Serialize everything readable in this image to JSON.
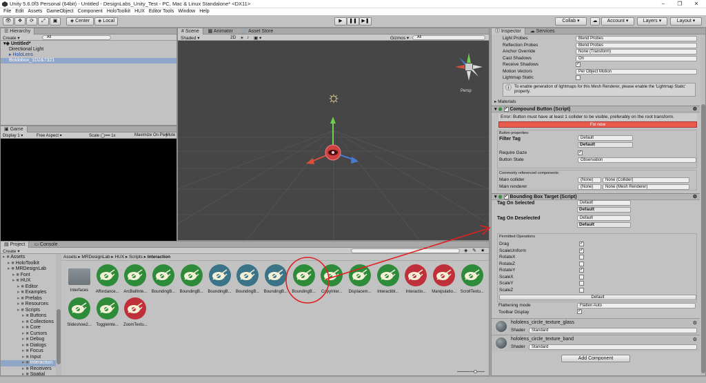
{
  "window": {
    "title": "Unity 5.6.0f3 Personal (64bit) - Untitled - DesignLabs_Unity_Test - PC, Mac & Linux Standalone* <DX11>"
  },
  "menu": [
    "File",
    "Edit",
    "Assets",
    "GameObject",
    "Component",
    "HoloToolkit",
    "HUX",
    "Editor Tools",
    "Window",
    "Help"
  ],
  "toolbar": {
    "center": "Center",
    "local": "Local",
    "collab": "Collab",
    "account": "Account",
    "layers": "Layers",
    "layout": "Layout"
  },
  "hierarchy": {
    "tab": "Hierarchy",
    "create": "Create",
    "search": "All",
    "items": [
      {
        "label": "Untitled*",
        "indent": 0,
        "bold": true
      },
      {
        "label": "Directional Light",
        "indent": 1
      },
      {
        "label": "HoloLens",
        "indent": 1,
        "blue": true
      },
      {
        "label": "Boldobox_1D2&7321",
        "indent": 1,
        "selected": true
      }
    ]
  },
  "scene": {
    "tabs": [
      "Scene",
      "Animator",
      "Asset Store"
    ],
    "shading": "Shaded",
    "mode_2d": "2D",
    "gizmos": "Gizmos",
    "search": "All",
    "persp": "Persp"
  },
  "game": {
    "tab": "Game",
    "display": "Display 1",
    "aspect": "Free Aspect",
    "scale": "Scale",
    "scale_val": "1x",
    "maximize": "Maximize On Play",
    "mute": "Mute"
  },
  "project": {
    "tabs": [
      "Project",
      "Console"
    ],
    "create": "Create",
    "breadcrumb": [
      "Assets",
      "MRDesignLab",
      "HUX",
      "Scripts",
      "Interaction"
    ],
    "tree": [
      {
        "label": "Assets",
        "indent": 0
      },
      {
        "label": "HoloToolkit",
        "indent": 1
      },
      {
        "label": "MRDesignLab",
        "indent": 1
      },
      {
        "label": "Font",
        "indent": 2
      },
      {
        "label": "HUX",
        "indent": 2
      },
      {
        "label": "Editor",
        "indent": 3
      },
      {
        "label": "Examples",
        "indent": 3
      },
      {
        "label": "Prefabs",
        "indent": 3
      },
      {
        "label": "Resources",
        "indent": 3
      },
      {
        "label": "Scripts",
        "indent": 3
      },
      {
        "label": "Buttons",
        "indent": 4
      },
      {
        "label": "Collections",
        "indent": 4
      },
      {
        "label": "Core",
        "indent": 4
      },
      {
        "label": "Cursors",
        "indent": 4
      },
      {
        "label": "Debug",
        "indent": 4
      },
      {
        "label": "Dialogs",
        "indent": 4
      },
      {
        "label": "Focus",
        "indent": 4
      },
      {
        "label": "Input",
        "indent": 4
      },
      {
        "label": "Interaction",
        "indent": 4,
        "selected": true
      },
      {
        "label": "Receivers",
        "indent": 4
      },
      {
        "label": "Spatial",
        "indent": 4
      }
    ],
    "assets": [
      {
        "label": "Interfaces",
        "color": "folder"
      },
      {
        "label": "Affordance...",
        "color": "#2e8b3a"
      },
      {
        "label": "ArcBallInte...",
        "color": "#2e8b3a"
      },
      {
        "label": "BoundingB...",
        "color": "#2e8b3a"
      },
      {
        "label": "BoundingB...",
        "color": "#2e8b3a"
      },
      {
        "label": "BoundingB...",
        "color": "#3b7388"
      },
      {
        "label": "BoundingB...",
        "color": "#3b7388"
      },
      {
        "label": "BoundingB...",
        "color": "#3b7388"
      },
      {
        "label": "BoundingB...",
        "color": "#2e8b3a"
      },
      {
        "label": "CopyInter...",
        "color": "#2e8b3a"
      },
      {
        "label": "Displacem...",
        "color": "#2e8b3a"
      },
      {
        "label": "Interactibl...",
        "color": "#2e8b3a"
      },
      {
        "label": "Interactio...",
        "color": "#c0303a"
      },
      {
        "label": "Manipulatio...",
        "color": "#c0303a"
      },
      {
        "label": "ScrollTextu...",
        "color": "#2e8b3a"
      },
      {
        "label": "Slideshow2...",
        "color": "#2e8b3a"
      },
      {
        "label": "ToggleInte...",
        "color": "#2e8b3a"
      },
      {
        "label": "ZoomTextu...",
        "color": "#c0303a"
      }
    ]
  },
  "inspector": {
    "tabs": [
      "Inspector",
      "Services"
    ],
    "renderer_rows": [
      {
        "label": "Light Probes",
        "value": "Blend Probes"
      },
      {
        "label": "Reflection Probes",
        "value": "Blend Probes"
      },
      {
        "label": "Anchor Override",
        "value": "None (Transform)"
      },
      {
        "label": "Cast Shadows",
        "value": "On"
      },
      {
        "label": "Receive Shadows",
        "value": "✓"
      },
      {
        "label": "Motion Vectors",
        "value": "Per Object Motion"
      },
      {
        "label": "Lightmap Static",
        "value": ""
      }
    ],
    "lightmap_info": "To enable generation of lightmaps for this Mesh Renderer, please enable the 'Lightmap Static' property.",
    "materials": "Materials",
    "compound": {
      "title": "Compound Button (Script)",
      "error": "Error: Button must have at least 1 collider to be visible, preferably on the root transform.",
      "fix": "Fix now",
      "props_title": "Button properties:",
      "filter_tag": "Filter Tag",
      "filter_dd": "Default",
      "filter_val": "Default",
      "require_gaze": "Require Gaze",
      "button_state": "Button State",
      "button_state_val": "Observation",
      "refs_title": "Commonly referenced components:",
      "main_collider": "Main collider",
      "none": "(None)",
      "collider_val": "None (Collider)",
      "main_renderer": "Main renderer",
      "renderer_val": "None (Mesh Renderer)"
    },
    "bbt": {
      "title": "Bounding Box Target (Script)",
      "tag_selected": "Tag On Selected",
      "tag_selected_dd": "Default",
      "tag_selected_val": "Default",
      "tag_deselected": "Tag On Deselected",
      "tag_deselected_dd": "Default",
      "tag_deselected_val": "Default",
      "permitted": "Permitted Operations",
      "ops": [
        {
          "label": "Drag",
          "checked": true
        },
        {
          "label": "ScaleUniform",
          "checked": true
        },
        {
          "label": "RotateX",
          "checked": false
        },
        {
          "label": "RotateZ",
          "checked": false
        },
        {
          "label": "RotateY",
          "checked": true
        },
        {
          "label": "ScaleX",
          "checked": false
        },
        {
          "label": "ScaleY",
          "checked": false
        },
        {
          "label": "ScaleZ",
          "checked": false
        }
      ],
      "default_btn": "Default",
      "flattening": "Flattening mode",
      "flattening_val": "Flatten Auto",
      "toolbar_display": "Toolbar Display"
    },
    "materials_list": [
      {
        "name": "hololens_circle_texture_glass",
        "shader": "Shader",
        "shader_val": "Standard"
      },
      {
        "name": "hololens_circle_texture_band",
        "shader": "Shader",
        "shader_val": "Standard"
      }
    ],
    "add_component": "Add Component"
  }
}
